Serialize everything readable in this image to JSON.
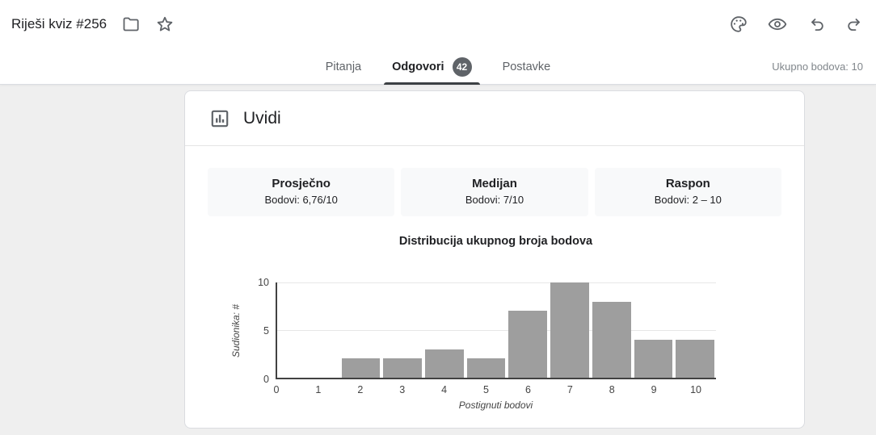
{
  "header": {
    "title": "Riješi kviz #256",
    "icons": [
      "folder-icon",
      "star-icon",
      "palette-icon",
      "preview-eye-icon",
      "undo-icon",
      "redo-icon"
    ]
  },
  "tabbar": {
    "tabs": [
      {
        "label": "Pitanja",
        "active": false
      },
      {
        "label": "Odgovori",
        "active": true,
        "badge": "42"
      },
      {
        "label": "Postavke",
        "active": false
      }
    ],
    "total_points": "Ukupno bodova: 10"
  },
  "card": {
    "title": "Uvidi",
    "stats": [
      {
        "title": "Prosječno",
        "value": "Bodovi: 6,76/10"
      },
      {
        "title": "Medijan",
        "value": "Bodovi: 7/10"
      },
      {
        "title": "Raspon",
        "value": "Bodovi: 2 – 10"
      }
    ]
  },
  "chart_data": {
    "type": "bar",
    "title": "Distribucija ukupnog broja bodova",
    "xlabel": "Postignuti bodovi",
    "ylabel": "Sudionika: #",
    "categories": [
      0,
      1,
      2,
      3,
      4,
      5,
      6,
      7,
      8,
      9,
      10
    ],
    "values": [
      0,
      0,
      2,
      2,
      3,
      2,
      7,
      10,
      8,
      4,
      4
    ],
    "ylim": [
      0,
      10
    ],
    "yticks": [
      0,
      5,
      10
    ],
    "x_extent": 10.5,
    "grid": "horizontal-light",
    "legend": "none"
  },
  "colors": {
    "bar": "#9e9e9e",
    "badge": "#5f6368",
    "tab_underline": "#3c4043",
    "icon": "#5f6368"
  }
}
